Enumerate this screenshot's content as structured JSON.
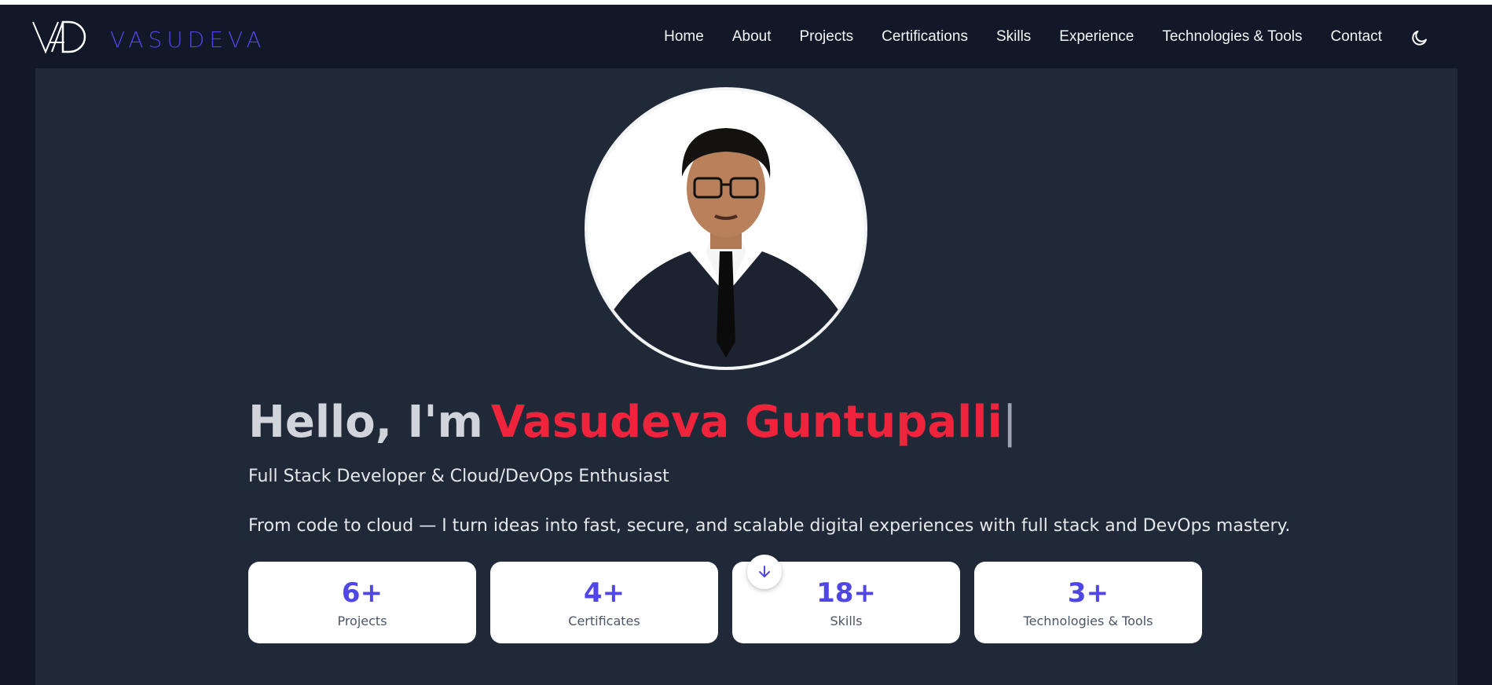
{
  "brand": {
    "name": "VASUDEVA",
    "logo_icon": "vd-monogram-logo",
    "accent": "#4f46e5"
  },
  "nav": {
    "items": [
      {
        "label": "Home"
      },
      {
        "label": "About"
      },
      {
        "label": "Projects"
      },
      {
        "label": "Certifications"
      },
      {
        "label": "Skills"
      },
      {
        "label": "Experience"
      },
      {
        "label": "Technologies & Tools"
      },
      {
        "label": "Contact"
      }
    ],
    "theme_toggle_icon": "moon-icon"
  },
  "hero": {
    "greeting": "Hello, I'm",
    "name": "Vasudeva Guntupalli",
    "cursor": "|",
    "name_color": "#ef233c",
    "subtitle": "Full Stack Developer & Cloud/DevOps Enthusiast",
    "tagline": "From code to cloud — I turn ideas into fast, secure, and scalable digital experiences with full stack and DevOps mastery.",
    "avatar_icon": "profile-photo",
    "scroll_icon": "arrow-down-icon"
  },
  "stats": [
    {
      "value": "6+",
      "label": "Projects"
    },
    {
      "value": "4+",
      "label": "Certificates"
    },
    {
      "value": "18+",
      "label": "Skills"
    },
    {
      "value": "3+",
      "label": "Technologies & Tools"
    }
  ]
}
